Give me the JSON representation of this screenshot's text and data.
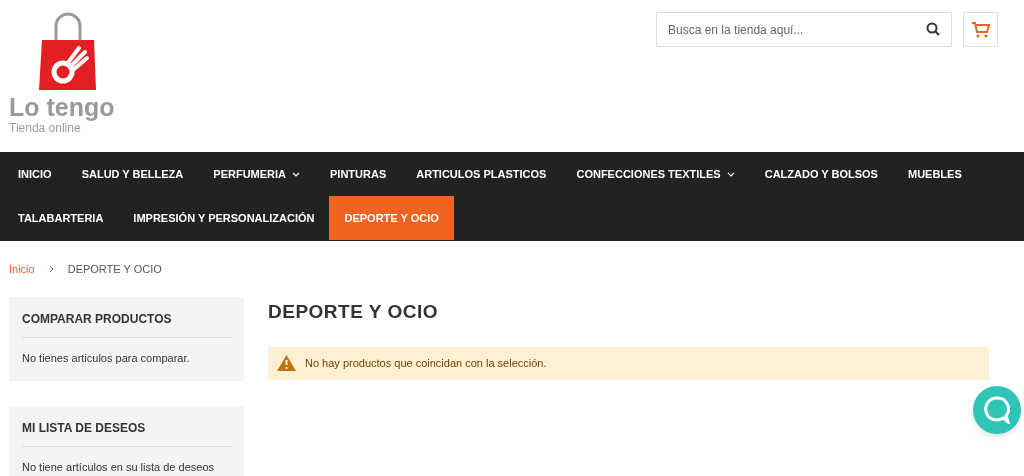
{
  "logo": {
    "name": "Lo tengo",
    "tagline": "Tienda online"
  },
  "search": {
    "placeholder": "Busca en la tienda aquí..."
  },
  "navigation": {
    "rows": [
      {
        "items": [
          {
            "label": "INICIO",
            "has_submenu": false,
            "selected": false
          },
          {
            "label": "SALUD Y BELLEZA",
            "has_submenu": false,
            "selected": false
          },
          {
            "label": "PERFUMERIA",
            "has_submenu": true,
            "selected": false
          },
          {
            "label": "PINTURAS",
            "has_submenu": false,
            "selected": false
          },
          {
            "label": "ARTICULOS PLASTICOS",
            "has_submenu": false,
            "selected": false
          },
          {
            "label": "CONFECCIONES TEXTILES",
            "has_submenu": true,
            "selected": false
          },
          {
            "label": "CALZADO Y BOLSOS",
            "has_submenu": false,
            "selected": false
          },
          {
            "label": "MUEBLES",
            "has_submenu": false,
            "selected": false
          }
        ]
      },
      {
        "items": [
          {
            "label": "TALABARTERIA",
            "has_submenu": false,
            "selected": false
          },
          {
            "label": "IMPRESIÓN Y PERSONALIZACIÓN",
            "has_submenu": false,
            "selected": false
          },
          {
            "label": "DEPORTE Y OCIO",
            "has_submenu": false,
            "selected": true
          }
        ]
      }
    ]
  },
  "breadcrumbs": [
    {
      "label": "Inicio",
      "kind": "link"
    },
    {
      "label": "DEPORTE Y OCIO",
      "kind": "current"
    }
  ],
  "sidebar": {
    "blocks": [
      {
        "title": "COMPARAR PRODUCTOS",
        "text": "No tienes articulos para comparar."
      },
      {
        "title": "MI LISTA DE DESEOS",
        "text": "No tiene artículos en su lista de deseos"
      }
    ]
  },
  "page_title": "DEPORTE Y OCIO",
  "notice": {
    "kind": "warning",
    "text": "No hay productos que coincidan con la selección."
  }
}
